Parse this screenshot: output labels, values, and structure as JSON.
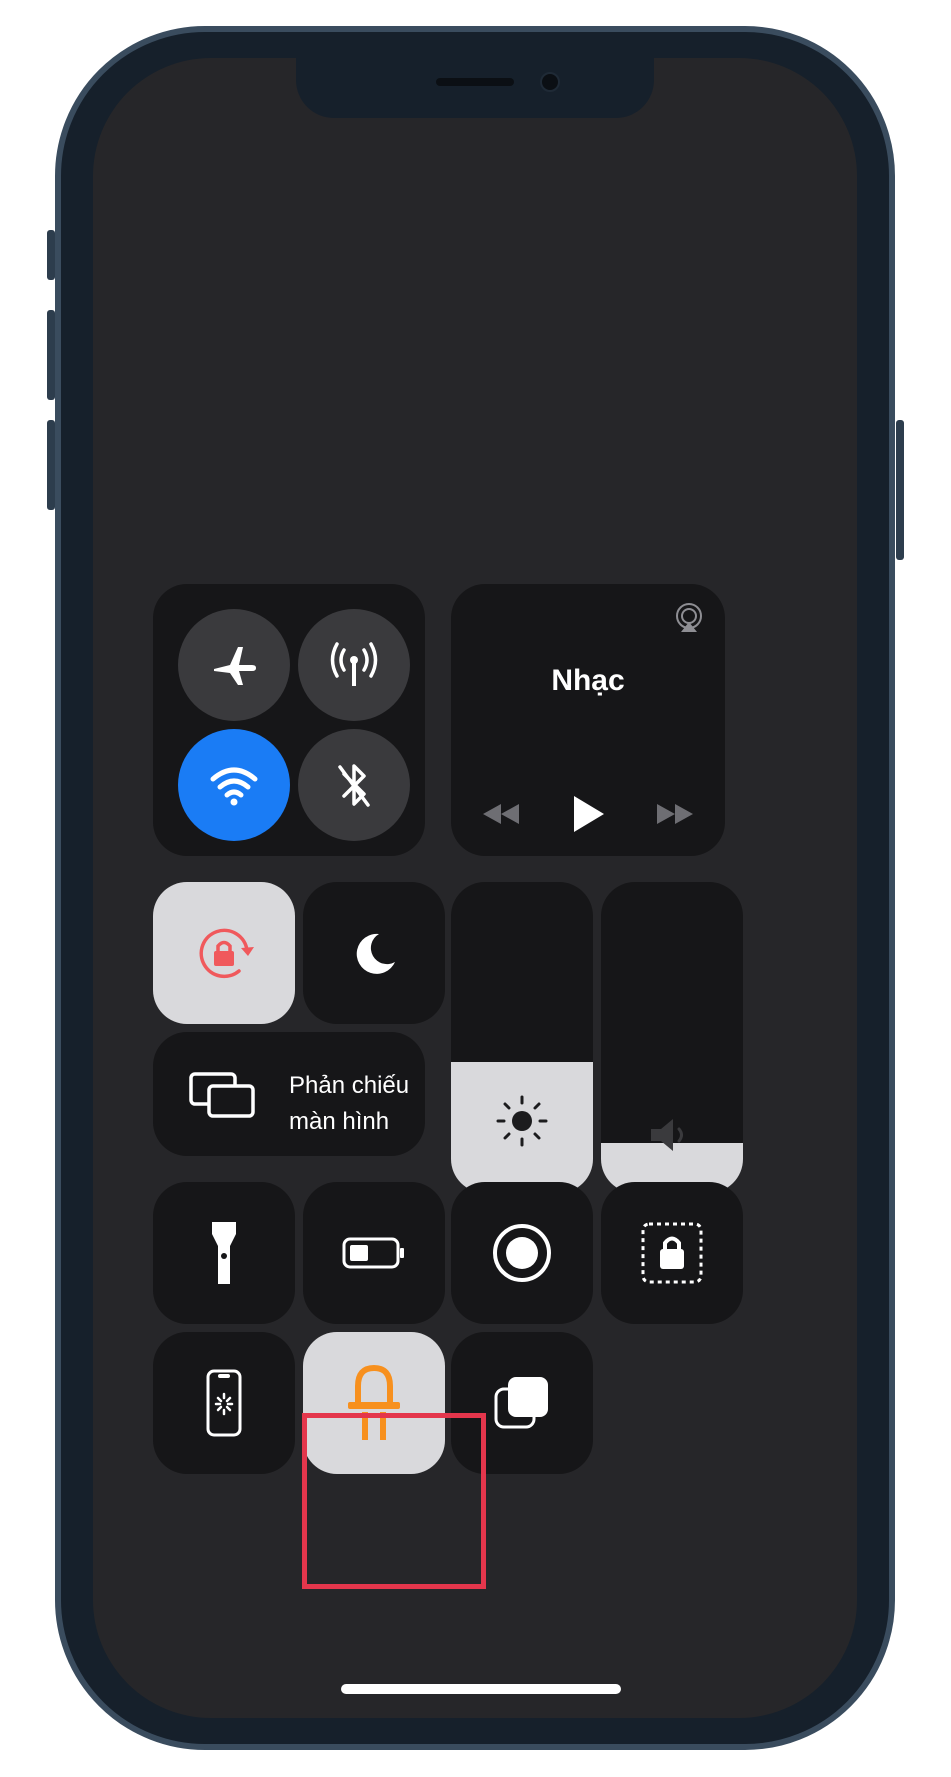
{
  "connectivity": {
    "airplane": {
      "icon": "airplane-icon",
      "active": false
    },
    "cellular": {
      "icon": "antenna-icon",
      "active": false
    },
    "wifi": {
      "icon": "wifi-icon",
      "active": true,
      "color": "#1a7cf5"
    },
    "bluetooth": {
      "icon": "bluetooth-off-icon",
      "active": false
    }
  },
  "music": {
    "title": "Nhạc",
    "airplay_icon": "airplay-icon",
    "controls": [
      "rewind-icon",
      "play-icon",
      "fast-forward-icon"
    ]
  },
  "tiles": {
    "rotation_lock": {
      "icon": "rotation-lock-icon",
      "active": true,
      "color": "#f0595c"
    },
    "do_not_disturb": {
      "icon": "moon-icon",
      "active": false
    },
    "screen_mirroring": {
      "icon": "screen-mirroring-icon",
      "line1": "Phản chiếu",
      "line2": "màn hình"
    },
    "flashlight": {
      "icon": "flashlight-icon"
    },
    "low_power": {
      "icon": "battery-icon"
    },
    "screen_record": {
      "icon": "record-icon"
    },
    "guided_access": {
      "icon": "guided-access-lock-icon"
    },
    "screen_time": {
      "icon": "phone-loading-icon"
    },
    "highlighted_app": {
      "icon": "led-bulb-icon",
      "active": true,
      "color": "#f7901e"
    },
    "multitask": {
      "icon": "stacked-squares-icon"
    }
  },
  "sliders": {
    "brightness": {
      "icon": "sun-icon",
      "level": 0.42
    },
    "volume": {
      "icon": "speaker-icon",
      "level": 0.16
    }
  },
  "highlight_color": "#e4364c"
}
